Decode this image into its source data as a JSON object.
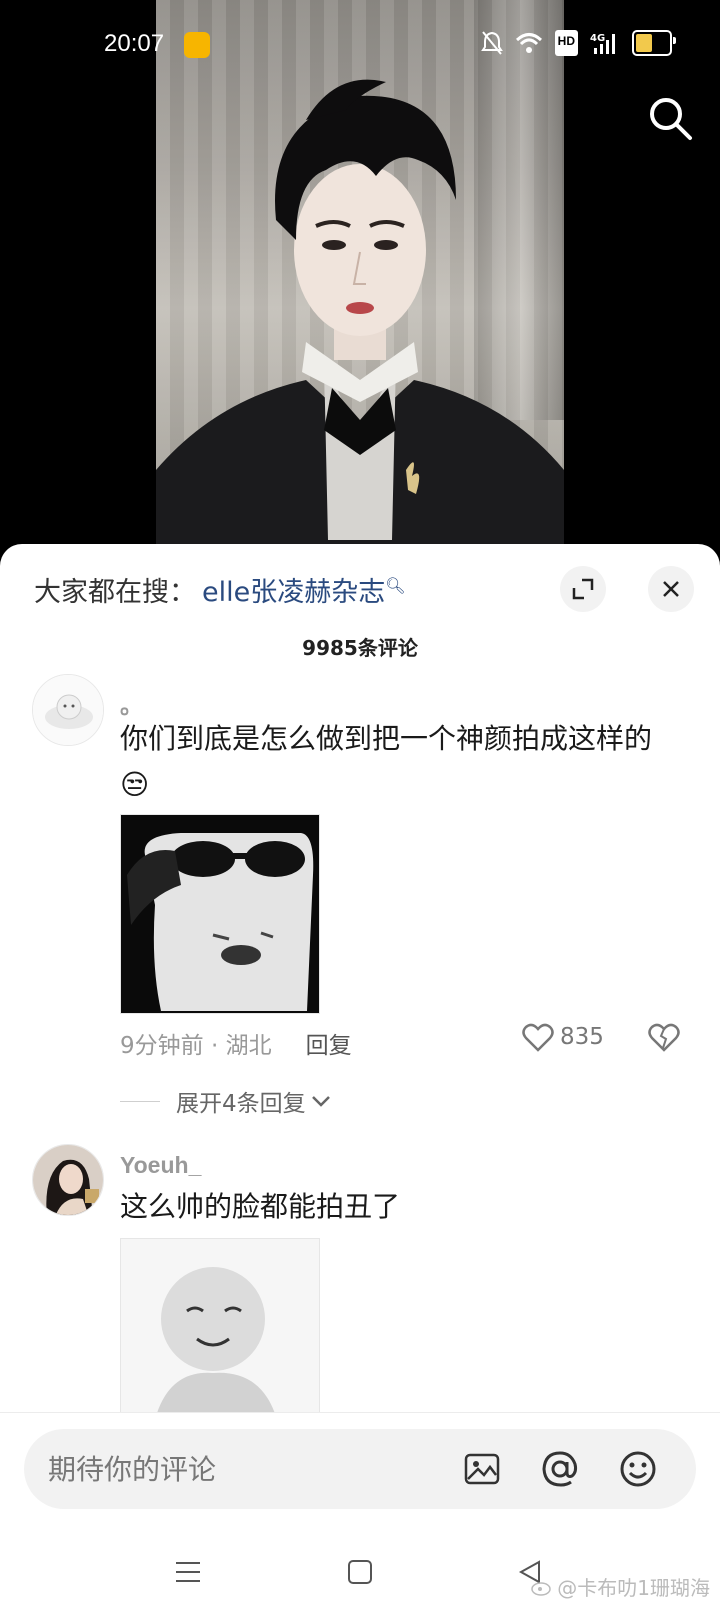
{
  "status_bar": {
    "time": "20:07",
    "hd": "HD",
    "network": "4G"
  },
  "video": {
    "icons": [
      "search-icon"
    ]
  },
  "sheet": {
    "hot_search_label": "大家都在搜：",
    "hot_search_term": "elle张凌赫杂志",
    "comment_count": "9985条评论"
  },
  "comments": [
    {
      "username": "。",
      "text": "你们到底是怎么做到把一个神颜拍成这样的",
      "emoji": "😒",
      "time_location": "9分钟前 · 湖北",
      "reply_label": "回复",
      "likes": "835",
      "expand_replies": "展开4条回复"
    },
    {
      "username": "Yoeuh_",
      "text": "这么帅的脸都能拍丑了"
    }
  ],
  "input_bar": {
    "placeholder": "期待你的评论"
  },
  "watermark": "@卡布叻1珊瑚海",
  "colors": {
    "link": "#2a4a7f",
    "battery": "#f2c94c",
    "weibo": "#f7b500"
  }
}
